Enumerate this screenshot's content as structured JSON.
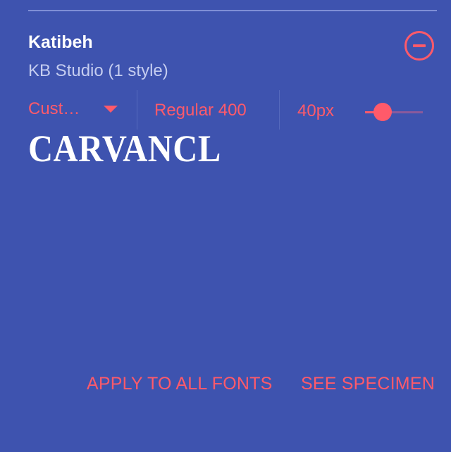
{
  "font_card": {
    "family": "Katibeh",
    "meta": "KB Studio (1 style)",
    "remove_icon": "minus-circle-icon",
    "preview_text_select": {
      "value": "Cust…",
      "icon": "arrow-drop-down-icon"
    },
    "weight_select": {
      "value": "Regular 400"
    },
    "size": {
      "label": "40px",
      "slider_fraction": 0.3
    },
    "preview_text": "CARVANCL",
    "actions": {
      "apply_all": "APPLY TO ALL FONTS",
      "see_specimen": "SEE SPECIMEN"
    }
  },
  "colors": {
    "background": "#3e53af",
    "accent": "#ff5a6a",
    "primary_text": "#ffffff",
    "secondary_text": "#c5cdf0"
  }
}
